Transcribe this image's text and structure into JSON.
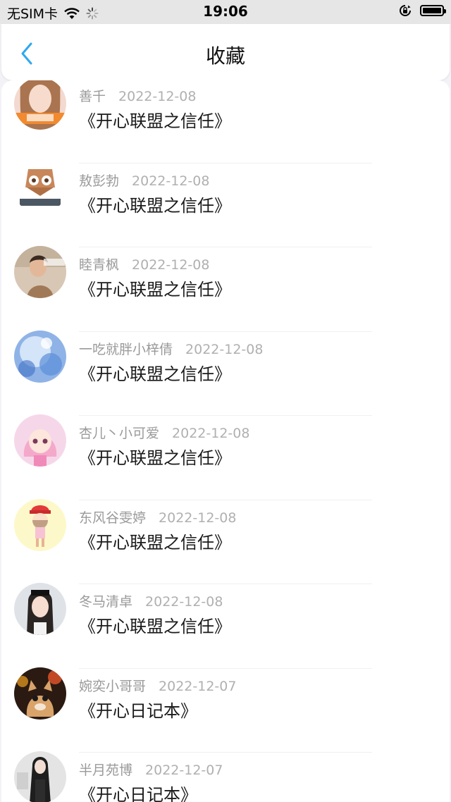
{
  "status_bar": {
    "carrier": "无SIM卡",
    "time": "19:06"
  },
  "nav": {
    "title": "收藏",
    "back_icon": "chevron-left-icon",
    "accent_color": "#2ea8f0"
  },
  "items": [
    {
      "name": "善千",
      "date": "2022-12-08",
      "title": "《开心联盟之信任》"
    },
    {
      "name": "敖彭勃",
      "date": "2022-12-08",
      "title": "《开心联盟之信任》"
    },
    {
      "name": "睦青枫",
      "date": "2022-12-08",
      "title": "《开心联盟之信任》"
    },
    {
      "name": "一吃就胖小梓倩",
      "date": "2022-12-08",
      "title": "《开心联盟之信任》"
    },
    {
      "name": "杏儿丶小可爱",
      "date": "2022-12-08",
      "title": "《开心联盟之信任》"
    },
    {
      "name": "东风谷雯婷",
      "date": "2022-12-08",
      "title": "《开心联盟之信任》"
    },
    {
      "name": "冬马清卓",
      "date": "2022-12-08",
      "title": "《开心联盟之信任》"
    },
    {
      "name": "婉奕小哥哥",
      "date": "2022-12-07",
      "title": "《开心日记本》"
    },
    {
      "name": "半月苑博",
      "date": "2022-12-07",
      "title": "《开心日记本》"
    }
  ]
}
